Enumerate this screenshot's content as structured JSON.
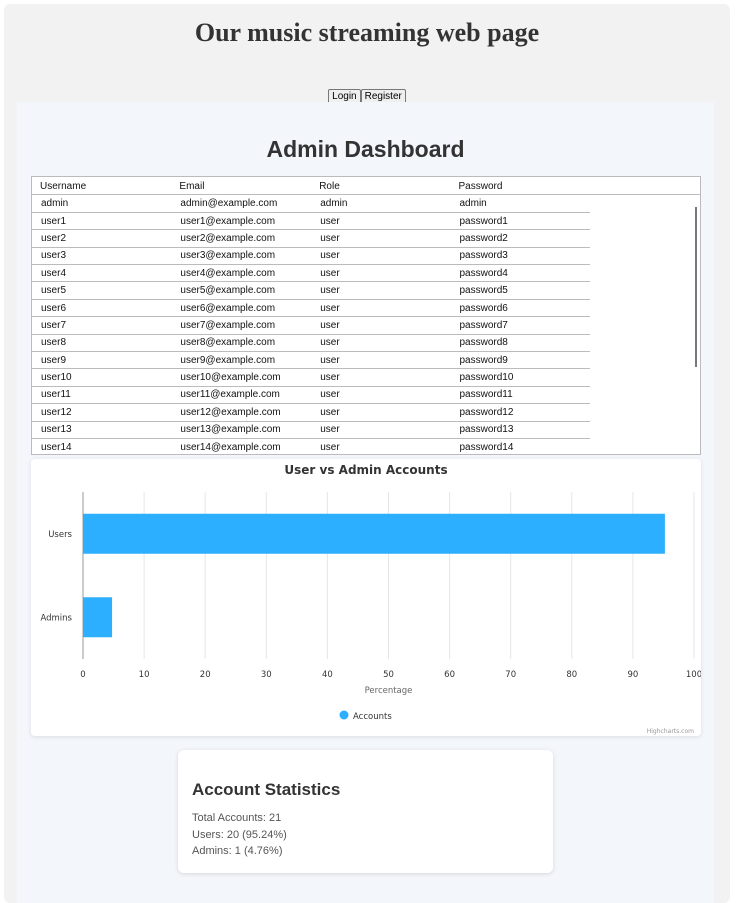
{
  "site": {
    "title": "Our music streaming web page",
    "login": "Login",
    "register": "Register"
  },
  "dashboard": {
    "title": "Admin Dashboard"
  },
  "table": {
    "headers": [
      "Username",
      "Email",
      "Role",
      "Password"
    ],
    "rows": [
      [
        "admin",
        "admin@example.com",
        "admin",
        "admin"
      ],
      [
        "user1",
        "user1@example.com",
        "user",
        "password1"
      ],
      [
        "user2",
        "user2@example.com",
        "user",
        "password2"
      ],
      [
        "user3",
        "user3@example.com",
        "user",
        "password3"
      ],
      [
        "user4",
        "user4@example.com",
        "user",
        "password4"
      ],
      [
        "user5",
        "user5@example.com",
        "user",
        "password5"
      ],
      [
        "user6",
        "user6@example.com",
        "user",
        "password6"
      ],
      [
        "user7",
        "user7@example.com",
        "user",
        "password7"
      ],
      [
        "user8",
        "user8@example.com",
        "user",
        "password8"
      ],
      [
        "user9",
        "user9@example.com",
        "user",
        "password9"
      ],
      [
        "user10",
        "user10@example.com",
        "user",
        "password10"
      ],
      [
        "user11",
        "user11@example.com",
        "user",
        "password11"
      ],
      [
        "user12",
        "user12@example.com",
        "user",
        "password12"
      ],
      [
        "user13",
        "user13@example.com",
        "user",
        "password13"
      ],
      [
        "user14",
        "user14@example.com",
        "user",
        "password14"
      ]
    ]
  },
  "chart_data": {
    "type": "bar",
    "orientation": "horizontal",
    "title": "User vs Admin Accounts",
    "categories": [
      "Users",
      "Admins"
    ],
    "series": [
      {
        "name": "Accounts",
        "values": [
          95.24,
          4.76
        ],
        "color": "#2caffe"
      }
    ],
    "xlabel": "Percentage",
    "xlim": [
      0,
      100
    ],
    "ticks": [
      0,
      10,
      20,
      30,
      40,
      50,
      60,
      70,
      80,
      90,
      100
    ],
    "grid": true,
    "legend": "bottom-center",
    "credits": "Highcharts.com"
  },
  "stats": {
    "title": "Account Statistics",
    "total": "Total Accounts: 21",
    "users": "Users: 20 (95.24%)",
    "admins": "Admins: 1 (4.76%)"
  }
}
